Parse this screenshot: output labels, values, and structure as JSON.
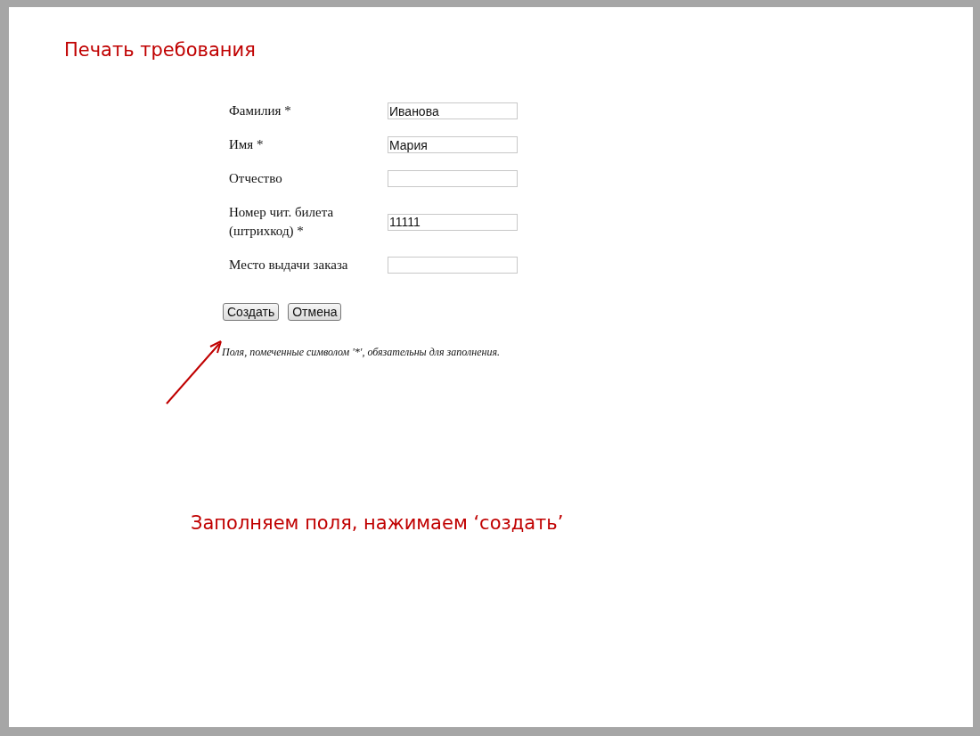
{
  "title": "Печать требования",
  "fields": [
    {
      "label": "Фамилия *",
      "value": "Иванова"
    },
    {
      "label": "Имя *",
      "value": "Мария"
    },
    {
      "label": "Отчество"
    },
    {
      "label": "Номер чит. билета (штрихкод) *",
      "value": "11111"
    },
    {
      "label": "Место выдачи заказа"
    }
  ],
  "buttons": [
    "Создать",
    "Отмена"
  ],
  "note": "Поля, помеченные символом '*', обязательны для заполнения.",
  "caption": "Заполняем поля, нажимаем ‘создать’"
}
